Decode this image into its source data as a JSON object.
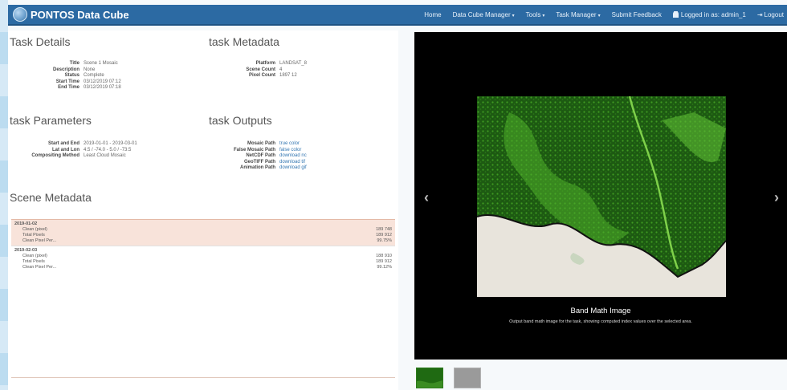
{
  "navbar": {
    "brand": "PONTOS Data Cube",
    "items": [
      {
        "label": "Home",
        "caret": false
      },
      {
        "label": "Data Cube Manager",
        "caret": true
      },
      {
        "label": "Tools",
        "caret": true
      },
      {
        "label": "Task Manager",
        "caret": true
      },
      {
        "label": "Submit Feedback",
        "caret": false
      }
    ],
    "user": "Logged in as: admin_1",
    "logout": "Logout"
  },
  "task_details": {
    "title": "Task Details",
    "rows": [
      {
        "k": "Title",
        "v": "Scene 1 Mosaic"
      },
      {
        "k": "Description",
        "v": "None"
      },
      {
        "k": "Status",
        "v": "Complete"
      },
      {
        "k": "Start Time",
        "v": "03/12/2019 07:12"
      },
      {
        "k": "End Time",
        "v": "03/12/2019 07:18"
      }
    ]
  },
  "task_metadata": {
    "title": "task Metadata",
    "rows": [
      {
        "k": "Platform",
        "v": "LANDSAT_8"
      },
      {
        "k": "Scene Count",
        "v": "4"
      },
      {
        "k": "Pixel Count",
        "v": "1897 12"
      }
    ]
  },
  "task_parameters": {
    "title": "task Parameters",
    "rows": [
      {
        "k": "Start and End",
        "v": "2019-01-01 - 2019-03-01"
      },
      {
        "k": "Lat and Lon",
        "v": "4.5 / -74.0 - 5.0 / -73.5"
      },
      {
        "k": "Compositing Method",
        "v": "Least Cloud Mosaic"
      }
    ]
  },
  "task_outputs": {
    "title": "task Outputs",
    "rows": [
      {
        "k": "Mosaic Path",
        "v": "true color"
      },
      {
        "k": "False Mosaic Path",
        "v": "false color"
      },
      {
        "k": "NetCDF Path",
        "v": "download nc"
      },
      {
        "k": "GeoTIFF Path",
        "v": "download tif"
      },
      {
        "k": "Animation Path",
        "v": "download gif"
      }
    ]
  },
  "scene_metadata": {
    "title": "Scene Metadata",
    "groups": [
      {
        "name": "2019-01-02",
        "highlight": true,
        "rows": [
          {
            "k": "Clean (pixel)",
            "v": "189 748"
          },
          {
            "k": "Total Pixels",
            "v": "189 912"
          },
          {
            "k": "Clean Pixel Per...",
            "v": "99.75%"
          }
        ]
      },
      {
        "name": "2019-02-03",
        "highlight": false,
        "rows": [
          {
            "k": "Clean (pixel)",
            "v": "188 910"
          },
          {
            "k": "Total Pixels",
            "v": "189 912"
          },
          {
            "k": "Clean Pixel Per...",
            "v": "99.12%"
          }
        ]
      }
    ]
  },
  "carousel": {
    "title": "Band Math Image",
    "description": "Output band math image for the task, showing computed index values over the selected area.",
    "prev_icon": "chevron-left-icon",
    "next_icon": "chevron-right-icon"
  },
  "colors": {
    "navbar": "#2c6aa3",
    "highlight_row": "#f8e3da",
    "link": "#3276b1"
  }
}
